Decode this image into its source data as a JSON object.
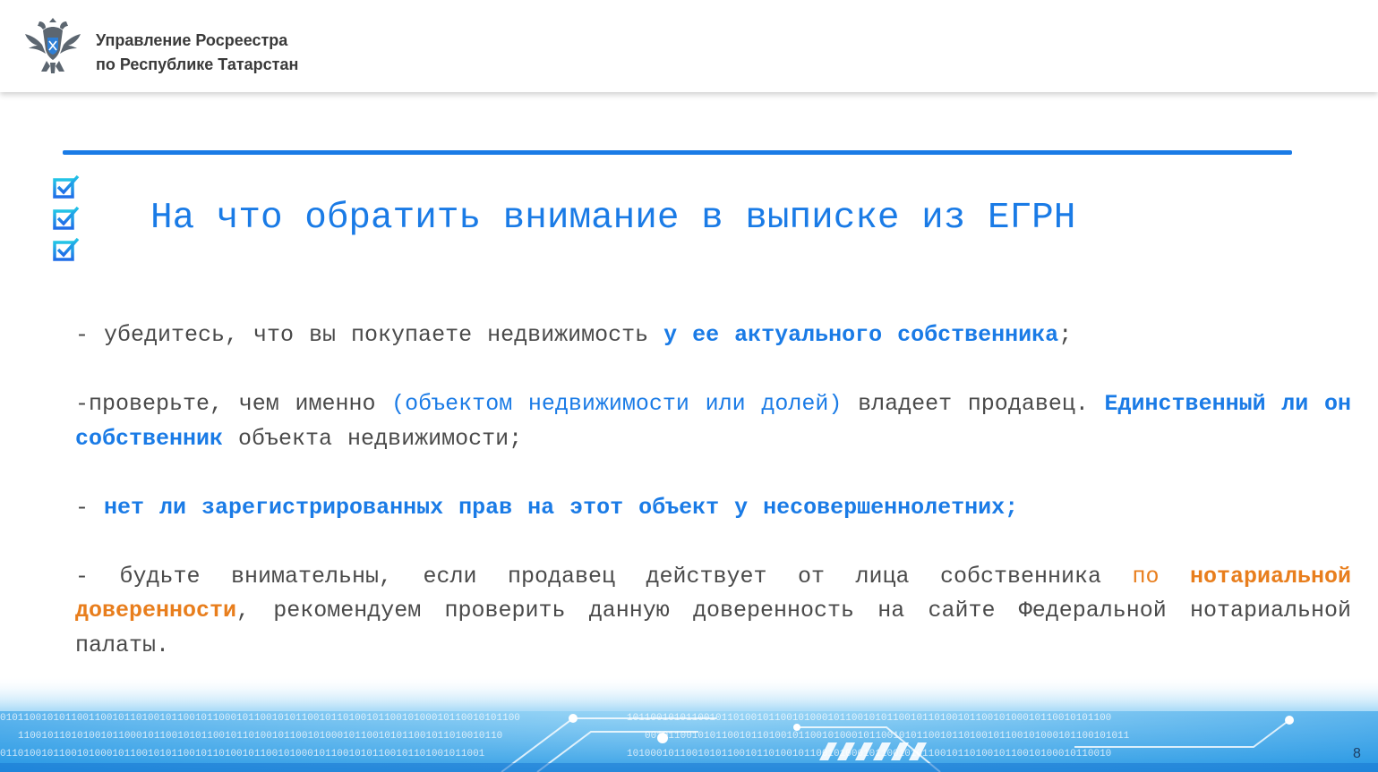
{
  "header": {
    "org_line1": "Управление Росреестра",
    "org_line2": "по Республике Татарстан",
    "logo_icon": "double-headed-eagle-emblem"
  },
  "colors": {
    "accent_blue": "#1a7be6",
    "accent_orange": "#e87e1d",
    "text_gray": "#4a4a4a"
  },
  "slide": {
    "title": "На что обратить внимание в выписке из ЕГРН",
    "title_icon": "checklist-icon"
  },
  "content": {
    "p1": {
      "t1": "- убедитесь, что  вы покупаете недвижимость ",
      "b1": "у ее актуального собственника",
      "t2": ";"
    },
    "p2": {
      "t1": "-проверьте, чем именно ",
      "l1": "(объектом недвижимости или долей)",
      "t2": " владеет продавец. ",
      "b1": "Единственный ли он собственник",
      "t3": " объекта недвижимости;"
    },
    "p3": {
      "t1": "- ",
      "b1": "нет ли зарегистрированных прав на этот объект у несовершеннолетних;"
    },
    "p4": {
      "t1": "- будьте внимательны, если продавец действует от лица собственника ",
      "o1": "по ",
      "ob1": "нотариальной доверенности",
      "t2": ", рекомендуем проверить данную доверенность на сайте Федеральной нотариальной палаты."
    }
  },
  "footer": {
    "page_number": "8",
    "background": "binary-code-tech-banner"
  }
}
